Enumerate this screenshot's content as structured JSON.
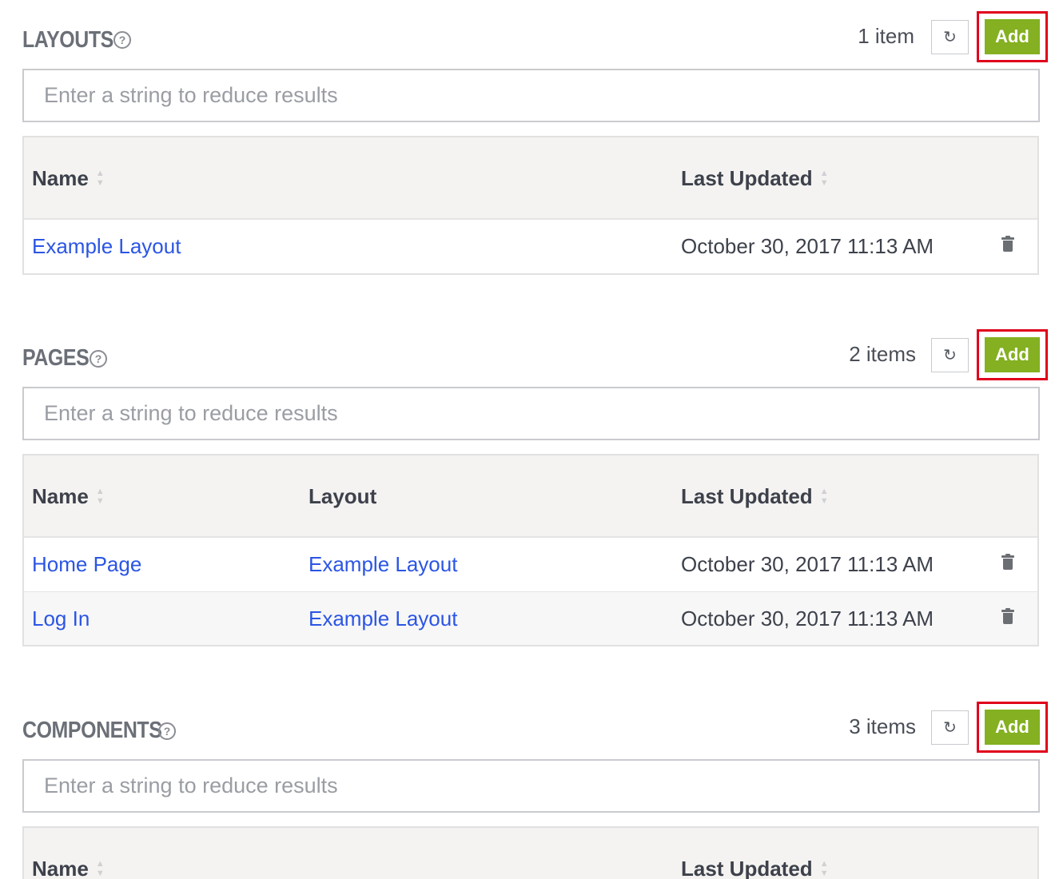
{
  "layouts": {
    "title": "LAYOUTS",
    "count": "1 item",
    "add_label": "Add",
    "refresh_icon": "refresh-icon",
    "filter_placeholder": "Enter a string to reduce results",
    "columns": {
      "name": "Name",
      "last_updated": "Last Updated"
    },
    "rows": [
      {
        "name": "Example Layout",
        "last_updated": "October 30, 2017 11:13 AM"
      }
    ]
  },
  "pages": {
    "title": "PAGES",
    "count": "2 items",
    "add_label": "Add",
    "refresh_icon": "refresh-icon",
    "filter_placeholder": "Enter a string to reduce results",
    "columns": {
      "name": "Name",
      "layout": "Layout",
      "last_updated": "Last Updated"
    },
    "rows": [
      {
        "name": "Home Page",
        "layout": "Example Layout",
        "last_updated": "October 30, 2017 11:13 AM"
      },
      {
        "name": "Log In",
        "layout": "Example Layout",
        "last_updated": "October 30, 2017 11:13 AM"
      }
    ]
  },
  "components": {
    "title": "COMPONENTS",
    "count": "3 items",
    "add_label": "Add",
    "refresh_icon": "refresh-icon",
    "filter_placeholder": "Enter a string to reduce results",
    "columns": {
      "name": "Name",
      "last_updated": "Last Updated"
    }
  },
  "colors": {
    "add_button": "#84b021",
    "highlight_box": "#e0001b",
    "link": "#2b55e4",
    "header_bg": "#f4f3f1"
  }
}
